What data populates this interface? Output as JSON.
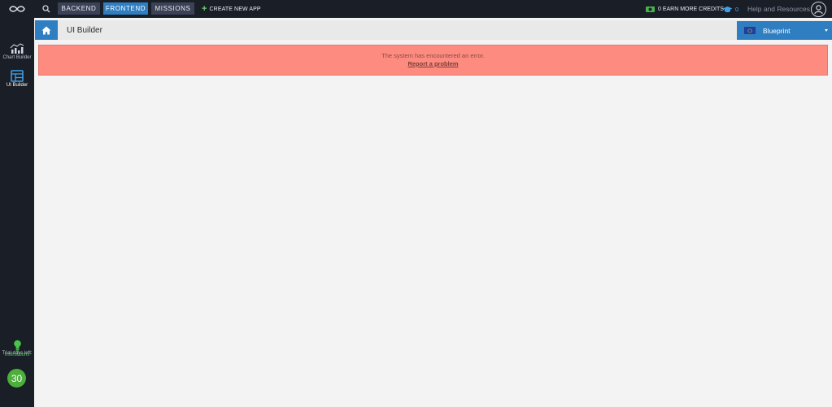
{
  "topbar": {
    "logo_icon": "infinity-logo",
    "search_icon": "search-icon",
    "tabs": [
      {
        "label": "BACKEND",
        "active": false
      },
      {
        "label": "FRONTEND",
        "active": true
      },
      {
        "label": "MISSIONS",
        "active": false
      }
    ],
    "create_label": "CREATE NEW APP",
    "credits_label": "0 EARN MORE CREDITS",
    "grad_count": "0",
    "help_label": "Help and Resources",
    "user_icon": "user-icon"
  },
  "sidebar": {
    "items": [
      {
        "label": "Chart Builder",
        "icon": "chart-icon",
        "active": false
      },
      {
        "label": "UI Builder",
        "icon": "ui-builder-icon",
        "active": true
      }
    ],
    "instructions_label": "Instructions",
    "trial_label": "Trial days left:",
    "trial_days": "30"
  },
  "header": {
    "home_icon": "home-icon",
    "title": "UI Builder",
    "blueprint_label": "Blueprint"
  },
  "alert": {
    "message": "The system has encountered an error.",
    "link": "Report a problem",
    "color": "#fd8b7f"
  },
  "colors": {
    "accent": "#2f7ec1",
    "dark": "#1a1e27",
    "green": "#4caf3c"
  }
}
